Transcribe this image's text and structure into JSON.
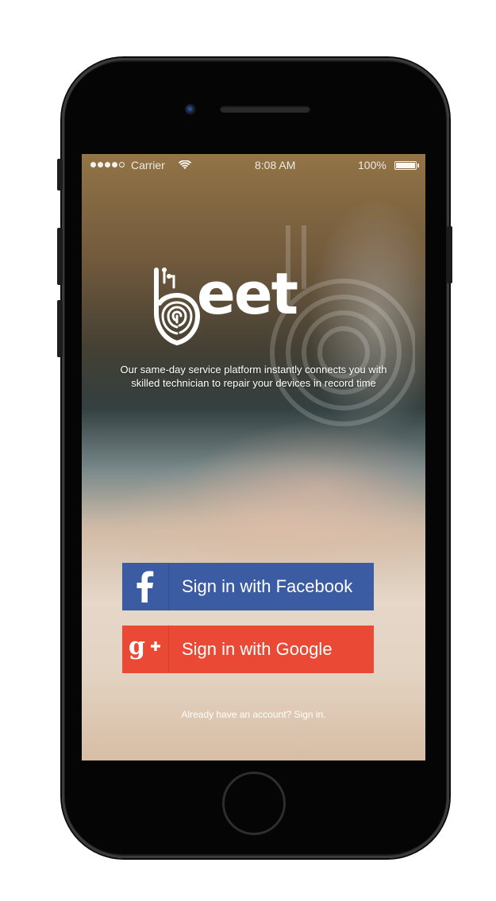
{
  "status_bar": {
    "carrier": "Carrier",
    "time": "8:08 AM",
    "battery": "100%",
    "signal_dots_filled": 4,
    "signal_dots_total": 5
  },
  "app": {
    "logo_text": "eet",
    "logo_icon": "fingerprint-b-icon",
    "tagline_line1": "Our same-day service platform instantly connects you with",
    "tagline_line2": "skilled technician to repair your devices in record time"
  },
  "buttons": {
    "facebook_label": "Sign in with Facebook",
    "facebook_icon": "facebook-f-icon",
    "google_label": "Sign in with Google",
    "google_icon": "google-plus-icon"
  },
  "footer": {
    "signin_prompt": "Already have an account? Sign in."
  },
  "colors": {
    "facebook": "#3b5ba3",
    "google": "#ea4a35",
    "text": "#ffffff"
  }
}
